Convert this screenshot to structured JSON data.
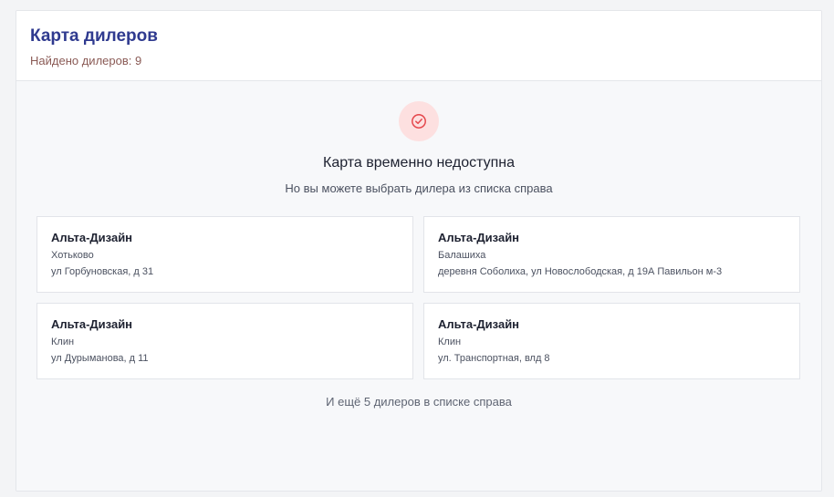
{
  "header": {
    "title": "Карта дилеров",
    "found_label": "Найдено дилеров: 9"
  },
  "map_unavailable": {
    "icon": "check-circle-icon",
    "heading": "Карта временно недоступна",
    "hint": "Но вы можете выбрать дилера из списка справа"
  },
  "dealers": [
    {
      "name": "Альта-Дизайн",
      "city": "Хотьково",
      "address": "ул Горбуновская, д 31"
    },
    {
      "name": "Альта-Дизайн",
      "city": "Балашиха",
      "address": "деревня Соболиха, ул Новослободская, д 19А Павильон м-3"
    },
    {
      "name": "Альта-Дизайн",
      "city": "Клин",
      "address": "ул Дурыманова, д 11"
    },
    {
      "name": "Альта-Дизайн",
      "city": "Клин",
      "address": "ул. Транспортная, влд 8"
    }
  ],
  "more_text": "И ещё 5 дилеров в списке справа",
  "colors": {
    "title": "#2f3a8f",
    "icon_bg": "#fde0e0",
    "icon_stroke": "#e5484d"
  }
}
